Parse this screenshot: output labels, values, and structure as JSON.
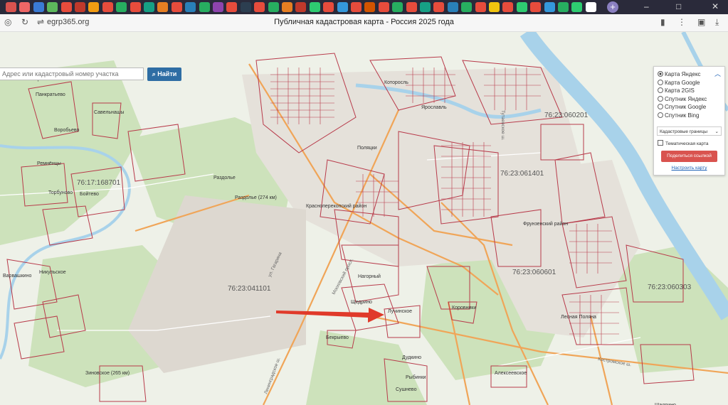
{
  "browser": {
    "url": "egrp365.org",
    "page_title": "Публичная кадастровая карта - Россия 2025 года"
  },
  "search": {
    "placeholder": "Адрес или кадастровый номер участка",
    "button_label": "Найти"
  },
  "layer_panel": {
    "base_layers": [
      "Карта Яндекс",
      "Карта Google",
      "Карта 2GIS",
      "Спутник Яндекс",
      "Спутник Google",
      "Спутник Bing"
    ],
    "selected": "Карта Яндекс",
    "cadastral_select": "Кадастровые границы",
    "thematic_label": "Тематическая карта",
    "share_button": "Поделиться ссылкой",
    "configure_link": "Настроить карту"
  },
  "map": {
    "cadastral_numbers": [
      "76:23:060201",
      "76:23:061401",
      "76:17:168701",
      "76:23:060601",
      "76:23:041101",
      "76:23:060303"
    ],
    "places": [
      "Кострово",
      "Панкратьево",
      "Савельнашы",
      "Воробьево",
      "Ремнёнцы",
      "Торбуново",
      "Бойтево",
      "Раздолье",
      "Раздолье (274 км)",
      "Поляцки",
      "Которосль",
      "Ярославль",
      "Красноперекопский район",
      "Фрунзенский район",
      "Нагорный",
      "Щедрино",
      "Лучинское",
      "Коровники",
      "Бекрыево",
      "Дудкино",
      "Лесная Поляна",
      "Зиновское (265 км)",
      "Алексеевское",
      "Рыбинки",
      "Сушнево",
      "Шадрино",
      "Никульское",
      "Варвашкино"
    ],
    "road_labels": [
      "Московский просп.",
      "Тутаевское ш.",
      "Костромское ш.",
      "Ленинградское ш.",
      "ул. Гагарина"
    ],
    "colors": {
      "parcel_border": "#b83a4a",
      "road": "#f0a558",
      "water": "#9ccce8",
      "forest": "#cfe3bd",
      "arrow": "#e03a2a"
    }
  }
}
